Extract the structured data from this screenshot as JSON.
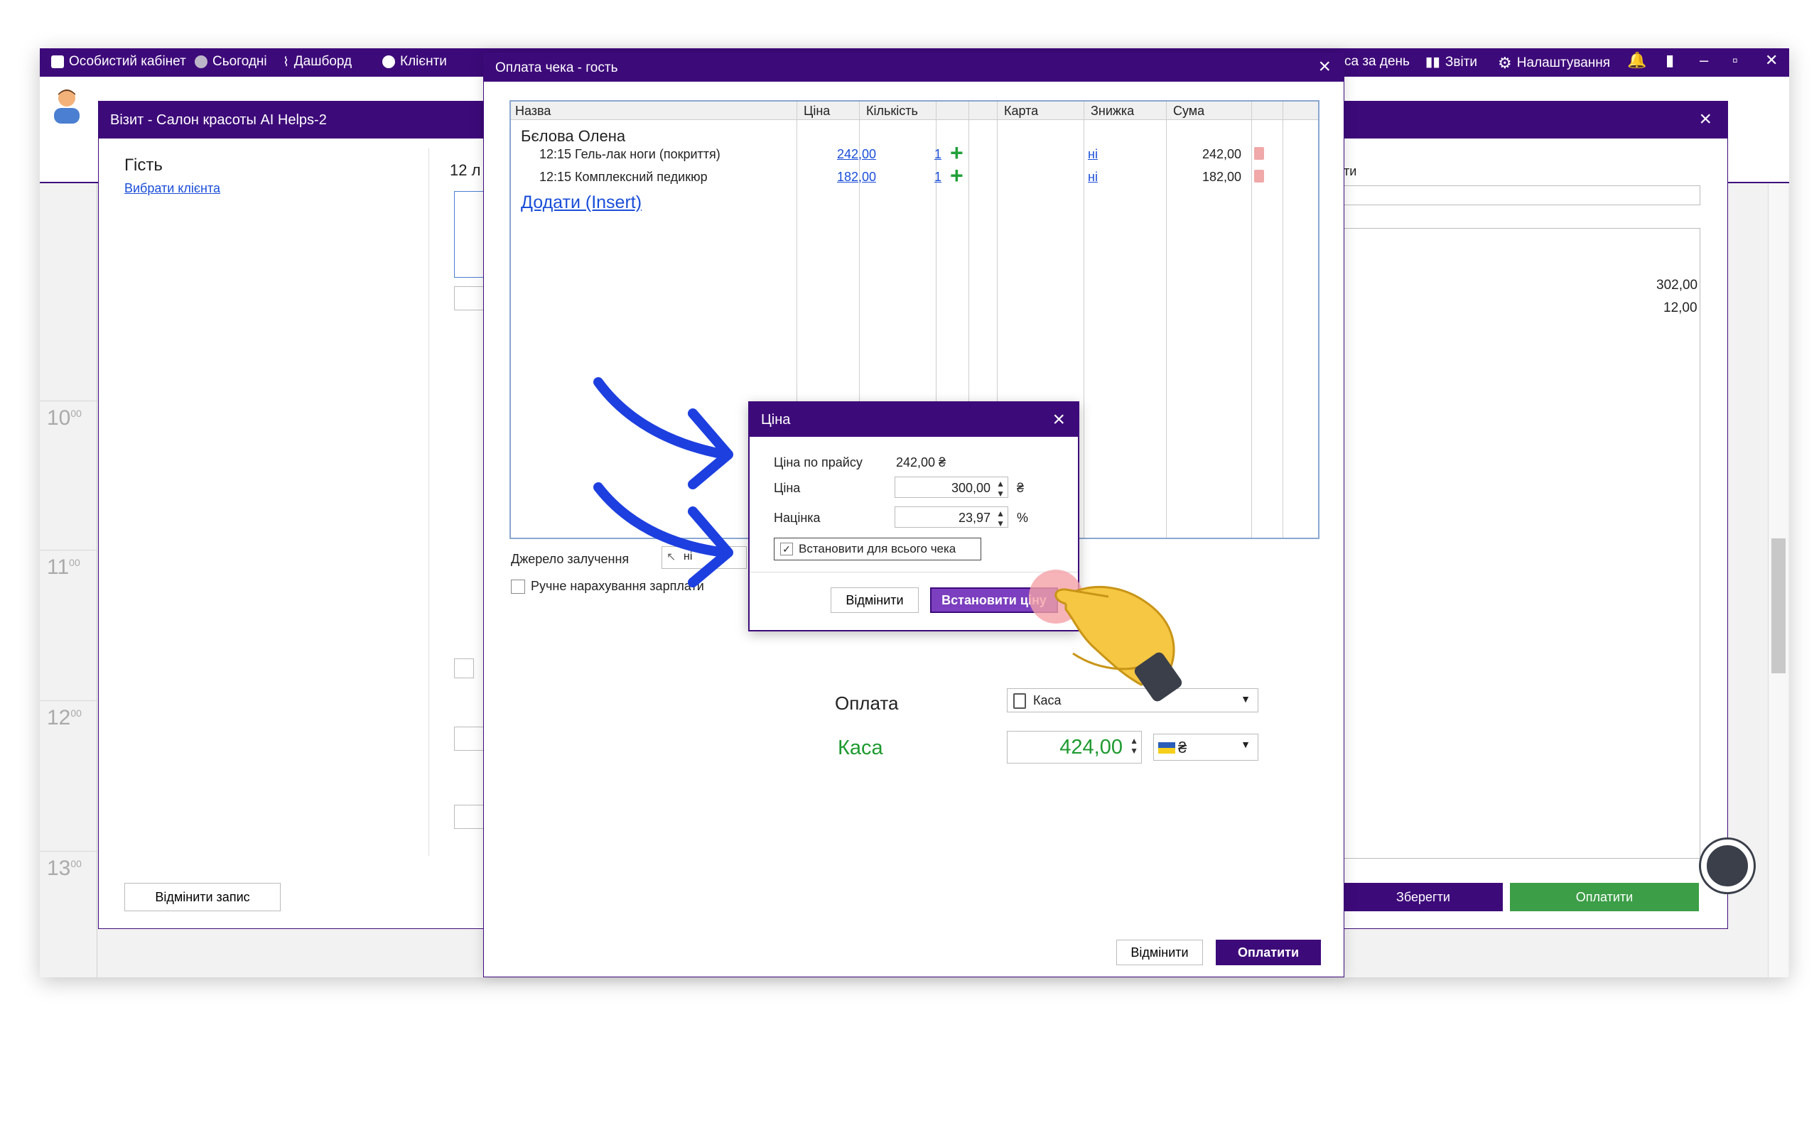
{
  "topbar": {
    "items": [
      {
        "label": "Особистий кабінет",
        "icon": "briefcase-icon"
      },
      {
        "label": "Сьогодні",
        "icon": "clock-icon"
      },
      {
        "label": "Дашборд",
        "icon": "pulse-icon"
      },
      {
        "label": "Клієнти",
        "icon": "user-circle-icon"
      }
    ],
    "right_items": [
      {
        "label": "са за день"
      },
      {
        "label": "Звіти",
        "icon": "bar-chart-icon"
      },
      {
        "label": "Налаштування",
        "icon": "gear-icon"
      }
    ],
    "window_controls": [
      "–",
      "▫",
      "✕"
    ]
  },
  "calendar": {
    "hours": [
      {
        "h": "10",
        "m": "00"
      },
      {
        "h": "11",
        "m": "00"
      },
      {
        "h": "12",
        "m": "00"
      },
      {
        "h": "13",
        "m": "00"
      }
    ]
  },
  "visit_window": {
    "title": "Візит - Салон красоты AI Helps-2",
    "guest_label": "Гість",
    "choose_client": "Вибрати клієнта",
    "date_fragment": "12 л",
    "right_label_fragment": "ти",
    "amounts": [
      "302,00",
      "12,00"
    ],
    "cancel_record": "Відмінити запис",
    "save": "Зберегти",
    "pay": "Оплатити"
  },
  "payment_window": {
    "title": "Оплата чека - гость",
    "columns": [
      "Назва",
      "Ціна",
      "Кількість",
      "Карта",
      "Знижка",
      "Сума"
    ],
    "client_name": "Бєлова Олена",
    "rows": [
      {
        "name": "12:15 Гель-лак ноги (покриття)",
        "price": "242,00",
        "qty": "1",
        "discount": "ні",
        "sum": "242,00"
      },
      {
        "name": "12:15 Комплексний педикюр",
        "price": "182,00",
        "qty": "1",
        "discount": "ні",
        "sum": "182,00"
      }
    ],
    "add_link": "Додати (Insert)",
    "source_label": "Джерело залучення",
    "source_value": "ні",
    "manual_salary": "Ручне нарахування зарплати",
    "payment_label": "Оплата",
    "payment_method": "Каса",
    "cash_label": "Каса",
    "cash_amount": "424,00",
    "currency": "₴",
    "cancel": "Відмінити",
    "pay": "Оплатити"
  },
  "price_dialog": {
    "title": "Ціна",
    "list_price_label": "Ціна по прайсу",
    "list_price_value": "242,00 ₴",
    "price_label": "Ціна",
    "price_value": "300,00",
    "price_unit": "₴",
    "markup_label": "Націнка",
    "markup_value": "23,97",
    "markup_unit": "%",
    "apply_all_label": "Встановити для всього чека",
    "apply_all_checked": true,
    "cancel": "Відмінити",
    "set_price": "Встановити ціну"
  },
  "colors": {
    "brand_purple": "#3d0a7a",
    "accent_purple": "#7b3fbf",
    "link_blue": "#1a4ed8",
    "success_green": "#1f9a30",
    "arrow_blue": "#1d3fe0"
  }
}
